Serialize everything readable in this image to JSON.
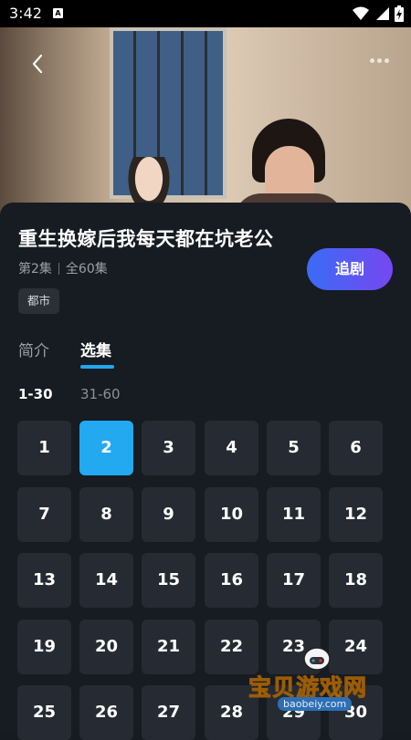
{
  "status_bar": {
    "time": "3:42",
    "a_badge": "A"
  },
  "video": {
    "back_icon": "chevron-left-icon",
    "more_icon": "more-dots-icon"
  },
  "drama": {
    "title": "重生换嫁后我每天都在坑老公",
    "current_episode": "第2集",
    "total_episodes": "全60集",
    "tag": "都市",
    "follow_label": "追剧"
  },
  "tabs": [
    {
      "label": "简介",
      "active": false
    },
    {
      "label": "选集",
      "active": true
    }
  ],
  "ranges": [
    {
      "label": "1-30",
      "active": true
    },
    {
      "label": "31-60",
      "active": false
    }
  ],
  "episodes": [
    "1",
    "2",
    "3",
    "4",
    "5",
    "6",
    "7",
    "8",
    "9",
    "10",
    "11",
    "12",
    "13",
    "14",
    "15",
    "16",
    "17",
    "18",
    "19",
    "20",
    "21",
    "22",
    "23",
    "24",
    "25",
    "26",
    "27",
    "28",
    "29",
    "30"
  ],
  "selected_episode": "2",
  "colors": {
    "accent": "#22a9f0",
    "follow_start": "#3a6cf4",
    "follow_end": "#7647f2",
    "sheet_bg": "#171b22",
    "tile_bg": "#262b33"
  },
  "watermark": {
    "text": "宝贝游戏网",
    "url": "baobeiy.com"
  }
}
